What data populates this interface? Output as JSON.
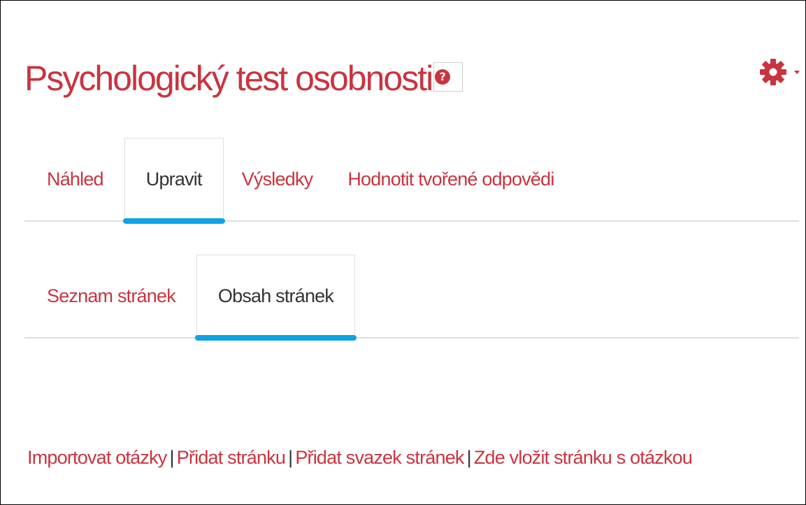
{
  "header": {
    "title": "Psychologický test osobnosti",
    "help_glyph": "?",
    "help_icon": "question-circle-icon",
    "settings_icon": "gear-icon"
  },
  "tabs_primary": [
    {
      "label": "Náhled",
      "active": false
    },
    {
      "label": "Upravit",
      "active": true
    },
    {
      "label": "Výsledky",
      "active": false
    },
    {
      "label": "Hodnotit tvořené odpovědi",
      "active": false
    }
  ],
  "tabs_secondary": [
    {
      "label": "Seznam stránek",
      "active": false
    },
    {
      "label": "Obsah stránek",
      "active": true
    }
  ],
  "actions": {
    "separator": "|",
    "links": [
      "Importovat otázky",
      "Přidat stránku",
      "Přidat svazek stránek",
      "Zde vložit stránku s otázkou"
    ]
  },
  "colors": {
    "link": "#c9343f",
    "text": "#333333",
    "active_tab_underline": "#10a3e3",
    "tab_border": "#dcdfe3"
  }
}
